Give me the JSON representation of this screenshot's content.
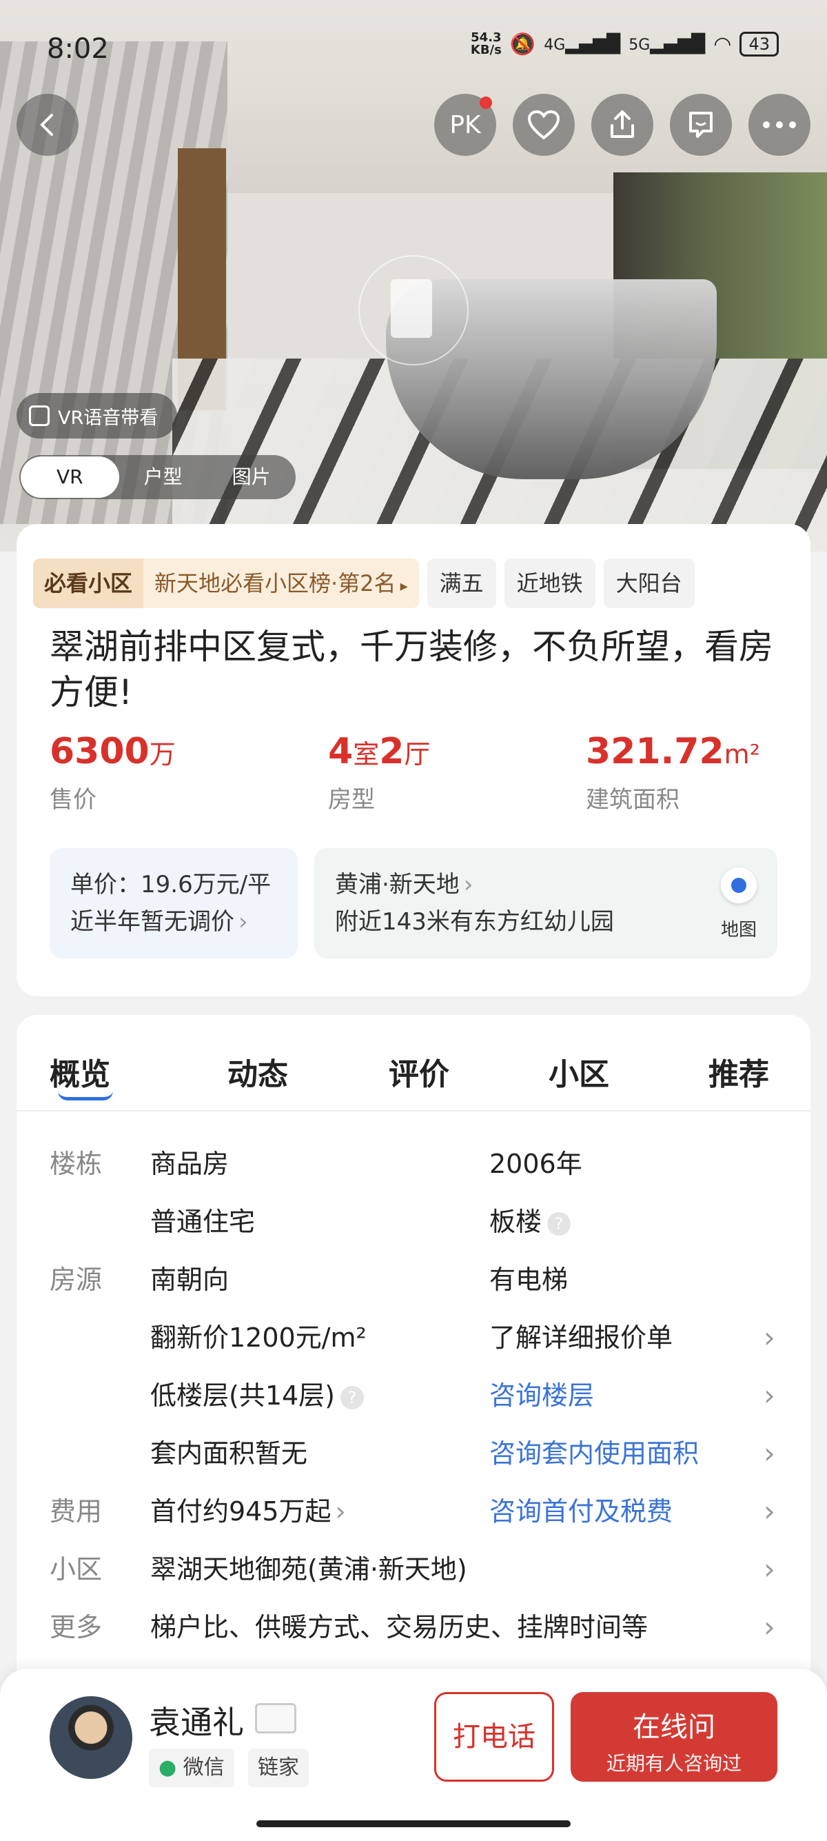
{
  "status_bar": {
    "time": "8:02",
    "net_speed_value": "54.3",
    "net_speed_unit": "KB/s",
    "signal_1": "4G",
    "signal_2": "5G",
    "battery": "43"
  },
  "top_buttons": {
    "pk": "PK"
  },
  "hero": {
    "vr_voice": "VR语音带看",
    "media_tabs": [
      "VR",
      "户型",
      "图片"
    ]
  },
  "tags": {
    "must_see": "必看小区",
    "ranking": "新天地必看小区榜·第2名",
    "ranking_arrow": "▸",
    "items": [
      "满五",
      "近地铁",
      "大阳台"
    ]
  },
  "title": "翠湖前排中区复式，千万装修，不负所望，看房方便!",
  "stats": {
    "price_value": "6300",
    "price_unit": "万",
    "price_label": "售价",
    "layout_num1": "4",
    "layout_unit1": "室",
    "layout_num2": "2",
    "layout_unit2": "厅",
    "layout_label": "房型",
    "area_value": "321.72",
    "area_unit": "m²",
    "area_label": "建筑面积"
  },
  "unit_price": {
    "line1": "单价：19.6万元/平",
    "line2": "近半年暂无调价"
  },
  "location": {
    "district": "黄浦·新天地",
    "nearby": "附近143米有东方红幼儿园",
    "map_label": "地图"
  },
  "tabs": [
    "概览",
    "动态",
    "评价",
    "小区",
    "推荐"
  ],
  "details": {
    "building_label": "楼栋",
    "building_rows": [
      [
        "商品房",
        "2006年"
      ],
      [
        "普通住宅",
        "板楼"
      ]
    ],
    "listing_label": "房源",
    "listing_rows": [
      [
        "南朝向",
        "有电梯"
      ],
      [
        "翻新价1200元/m²",
        "了解详细报价单"
      ],
      [
        "低楼层(共14层)",
        "咨询楼层"
      ],
      [
        "套内面积暂无",
        "咨询套内使用面积"
      ]
    ],
    "fee_label": "费用",
    "fee_value": "首付约945万起",
    "fee_link": "咨询首付及税费",
    "community_label": "小区",
    "community_value": "翠湖天地御苑(黄浦·新天地)",
    "more_label": "更多",
    "more_value": "梯户比、供暖方式、交易历史、挂牌时间等"
  },
  "agent": {
    "name": "袁通礼",
    "tag_wechat": "微信",
    "tag_company": "链家"
  },
  "actions": {
    "call": "打电话",
    "online": "在线问",
    "online_sub": "近期有人咨询过"
  },
  "colors": {
    "accent_red": "#d8312b",
    "link_blue": "#3b74d8"
  }
}
